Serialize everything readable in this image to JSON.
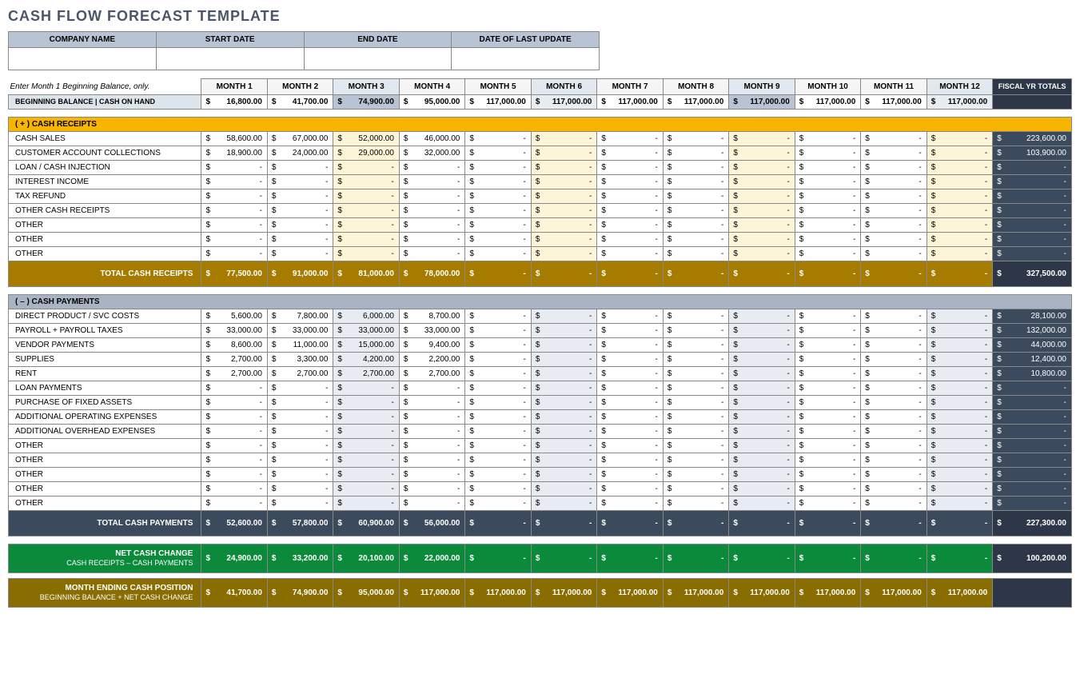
{
  "title": "CASH FLOW FORECAST TEMPLATE",
  "meta_headers": [
    "COMPANY NAME",
    "START DATE",
    "END DATE",
    "DATE OF LAST UPDATE"
  ],
  "meta_values": [
    "",
    "",
    "",
    ""
  ],
  "hint": "Enter Month 1 Beginning Balance, only.",
  "month_labels": [
    "MONTH 1",
    "MONTH 2",
    "MONTH 3",
    "MONTH 4",
    "MONTH 5",
    "MONTH 6",
    "MONTH 7",
    "MONTH 8",
    "MONTH 9",
    "MONTH 10",
    "MONTH 11",
    "MONTH 12"
  ],
  "fiscal_label": "FISCAL YR TOTALS",
  "beginning_balance": {
    "label": "BEGINNING BALANCE  |  CASH ON HAND",
    "values": [
      "16,800.00",
      "41,700.00",
      "74,900.00",
      "95,000.00",
      "117,000.00",
      "117,000.00",
      "117,000.00",
      "117,000.00",
      "117,000.00",
      "117,000.00",
      "117,000.00",
      "117,000.00"
    ],
    "fiscal": ""
  },
  "receipts": {
    "section_label": "( + )   CASH RECEIPTS",
    "rows": [
      {
        "label": "CASH SALES",
        "values": [
          "58,600.00",
          "67,000.00",
          "52,000.00",
          "46,000.00",
          "-",
          "-",
          "-",
          "-",
          "-",
          "-",
          "-",
          "-"
        ],
        "fiscal": "223,600.00"
      },
      {
        "label": "CUSTOMER ACCOUNT COLLECTIONS",
        "values": [
          "18,900.00",
          "24,000.00",
          "29,000.00",
          "32,000.00",
          "-",
          "-",
          "-",
          "-",
          "-",
          "-",
          "-",
          "-"
        ],
        "fiscal": "103,900.00"
      },
      {
        "label": "LOAN / CASH INJECTION",
        "values": [
          "-",
          "-",
          "-",
          "-",
          "-",
          "-",
          "-",
          "-",
          "-",
          "-",
          "-",
          "-"
        ],
        "fiscal": "-"
      },
      {
        "label": "INTEREST INCOME",
        "values": [
          "-",
          "-",
          "-",
          "-",
          "-",
          "-",
          "-",
          "-",
          "-",
          "-",
          "-",
          "-"
        ],
        "fiscal": "-"
      },
      {
        "label": "TAX REFUND",
        "values": [
          "-",
          "-",
          "-",
          "-",
          "-",
          "-",
          "-",
          "-",
          "-",
          "-",
          "-",
          "-"
        ],
        "fiscal": "-"
      },
      {
        "label": "OTHER CASH RECEIPTS",
        "values": [
          "-",
          "-",
          "-",
          "-",
          "-",
          "-",
          "-",
          "-",
          "-",
          "-",
          "-",
          "-"
        ],
        "fiscal": "-"
      },
      {
        "label": "OTHER",
        "values": [
          "-",
          "-",
          "-",
          "-",
          "-",
          "-",
          "-",
          "-",
          "-",
          "-",
          "-",
          "-"
        ],
        "fiscal": "-"
      },
      {
        "label": "OTHER",
        "values": [
          "-",
          "-",
          "-",
          "-",
          "-",
          "-",
          "-",
          "-",
          "-",
          "-",
          "-",
          "-"
        ],
        "fiscal": "-"
      },
      {
        "label": "OTHER",
        "values": [
          "-",
          "-",
          "-",
          "-",
          "-",
          "-",
          "-",
          "-",
          "-",
          "-",
          "-",
          "-"
        ],
        "fiscal": "-"
      }
    ],
    "total_label": "TOTAL CASH RECEIPTS",
    "total_values": [
      "77,500.00",
      "91,000.00",
      "81,000.00",
      "78,000.00",
      "-",
      "-",
      "-",
      "-",
      "-",
      "-",
      "-",
      "-"
    ],
    "total_fiscal": "327,500.00"
  },
  "payments": {
    "section_label": "( – )   CASH PAYMENTS",
    "rows": [
      {
        "label": "DIRECT PRODUCT / SVC COSTS",
        "values": [
          "5,600.00",
          "7,800.00",
          "6,000.00",
          "8,700.00",
          "-",
          "-",
          "-",
          "-",
          "-",
          "-",
          "-",
          "-"
        ],
        "fiscal": "28,100.00"
      },
      {
        "label": "PAYROLL + PAYROLL TAXES",
        "values": [
          "33,000.00",
          "33,000.00",
          "33,000.00",
          "33,000.00",
          "-",
          "-",
          "-",
          "-",
          "-",
          "-",
          "-",
          "-"
        ],
        "fiscal": "132,000.00"
      },
      {
        "label": "VENDOR PAYMENTS",
        "values": [
          "8,600.00",
          "11,000.00",
          "15,000.00",
          "9,400.00",
          "-",
          "-",
          "-",
          "-",
          "-",
          "-",
          "-",
          "-"
        ],
        "fiscal": "44,000.00"
      },
      {
        "label": "SUPPLIES",
        "values": [
          "2,700.00",
          "3,300.00",
          "4,200.00",
          "2,200.00",
          "-",
          "-",
          "-",
          "-",
          "-",
          "-",
          "-",
          "-"
        ],
        "fiscal": "12,400.00"
      },
      {
        "label": "RENT",
        "values": [
          "2,700.00",
          "2,700.00",
          "2,700.00",
          "2,700.00",
          "-",
          "-",
          "-",
          "-",
          "-",
          "-",
          "-",
          "-"
        ],
        "fiscal": "10,800.00"
      },
      {
        "label": "LOAN PAYMENTS",
        "values": [
          "-",
          "-",
          "-",
          "-",
          "-",
          "-",
          "-",
          "-",
          "-",
          "-",
          "-",
          "-"
        ],
        "fiscal": "-"
      },
      {
        "label": "PURCHASE OF FIXED ASSETS",
        "values": [
          "-",
          "-",
          "-",
          "-",
          "-",
          "-",
          "-",
          "-",
          "-",
          "-",
          "-",
          "-"
        ],
        "fiscal": "-"
      },
      {
        "label": "ADDITIONAL OPERATING EXPENSES",
        "values": [
          "-",
          "-",
          "-",
          "-",
          "-",
          "-",
          "-",
          "-",
          "-",
          "-",
          "-",
          "-"
        ],
        "fiscal": "-"
      },
      {
        "label": "ADDITIONAL OVERHEAD EXPENSES",
        "values": [
          "-",
          "-",
          "-",
          "-",
          "-",
          "-",
          "-",
          "-",
          "-",
          "-",
          "-",
          "-"
        ],
        "fiscal": "-"
      },
      {
        "label": "OTHER",
        "values": [
          "-",
          "-",
          "-",
          "-",
          "-",
          "-",
          "-",
          "-",
          "-",
          "-",
          "-",
          "-"
        ],
        "fiscal": "-"
      },
      {
        "label": "OTHER",
        "values": [
          "-",
          "-",
          "-",
          "-",
          "-",
          "-",
          "-",
          "-",
          "-",
          "-",
          "-",
          "-"
        ],
        "fiscal": "-"
      },
      {
        "label": "OTHER",
        "values": [
          "-",
          "-",
          "-",
          "-",
          "-",
          "-",
          "-",
          "-",
          "-",
          "-",
          "-",
          "-"
        ],
        "fiscal": "-"
      },
      {
        "label": "OTHER",
        "values": [
          "-",
          "-",
          "-",
          "-",
          "-",
          "-",
          "-",
          "-",
          "-",
          "-",
          "-",
          "-"
        ],
        "fiscal": "-"
      },
      {
        "label": "OTHER",
        "values": [
          "-",
          "-",
          "-",
          "-",
          "-",
          "-",
          "-",
          "-",
          "-",
          "-",
          "-",
          "-"
        ],
        "fiscal": "-"
      }
    ],
    "total_label": "TOTAL CASH PAYMENTS",
    "total_values": [
      "52,600.00",
      "57,800.00",
      "60,900.00",
      "56,000.00",
      "-",
      "-",
      "-",
      "-",
      "-",
      "-",
      "-",
      "-"
    ],
    "total_fiscal": "227,300.00"
  },
  "net_change": {
    "label": "NET CASH CHANGE",
    "sublabel": "CASH RECEIPTS – CASH PAYMENTS",
    "values": [
      "24,900.00",
      "33,200.00",
      "20,100.00",
      "22,000.00",
      "-",
      "-",
      "-",
      "-",
      "-",
      "-",
      "-",
      "-"
    ],
    "fiscal": "100,200.00"
  },
  "ending": {
    "label": "MONTH ENDING CASH POSITION",
    "sublabel": "BEGINNING BALANCE + NET CASH CHANGE",
    "values": [
      "41,700.00",
      "74,900.00",
      "95,000.00",
      "117,000.00",
      "117,000.00",
      "117,000.00",
      "117,000.00",
      "117,000.00",
      "117,000.00",
      "117,000.00",
      "117,000.00",
      "117,000.00"
    ],
    "fiscal": ""
  },
  "tint_indices_yellow": [
    2,
    5,
    8,
    11
  ],
  "tint_indices_blue": [
    2,
    5,
    8,
    11
  ]
}
